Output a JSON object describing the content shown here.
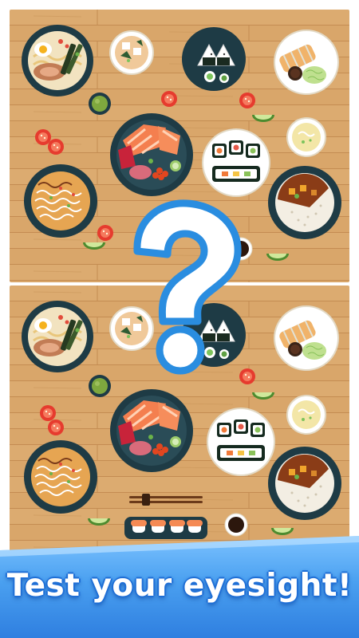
{
  "game": {
    "banner_text": "Test your eyesight!",
    "hint_symbol": "?",
    "colors": {
      "table_wood": "#d9a66a",
      "bowl_dark": "#1e3b45",
      "banner_blue": "#3a8ee8",
      "question_outline": "#2a8de0"
    },
    "top_panel": {
      "items": [
        "ramen-bowl",
        "tofu-soup",
        "onigiri-plate",
        "katsu-plate",
        "green-tea",
        "sashimi-bowl",
        "sushi-roll-plate",
        "egg-soup",
        "yakisoba-bowl",
        "curry-rice-bowl",
        "tomato-slices",
        "cucumber-slices",
        "soy-sauce"
      ]
    },
    "bottom_panel": {
      "items": [
        "ramen-bowl",
        "tofu-soup",
        "onigiri-plate",
        "katsu-plate",
        "green-tea",
        "sashimi-bowl",
        "sushi-roll-plate",
        "egg-soup",
        "yakisoba-bowl",
        "curry-rice-bowl",
        "tomato-slices",
        "cucumber-slices",
        "soy-sauce",
        "nigiri-tray",
        "chopsticks"
      ]
    }
  }
}
